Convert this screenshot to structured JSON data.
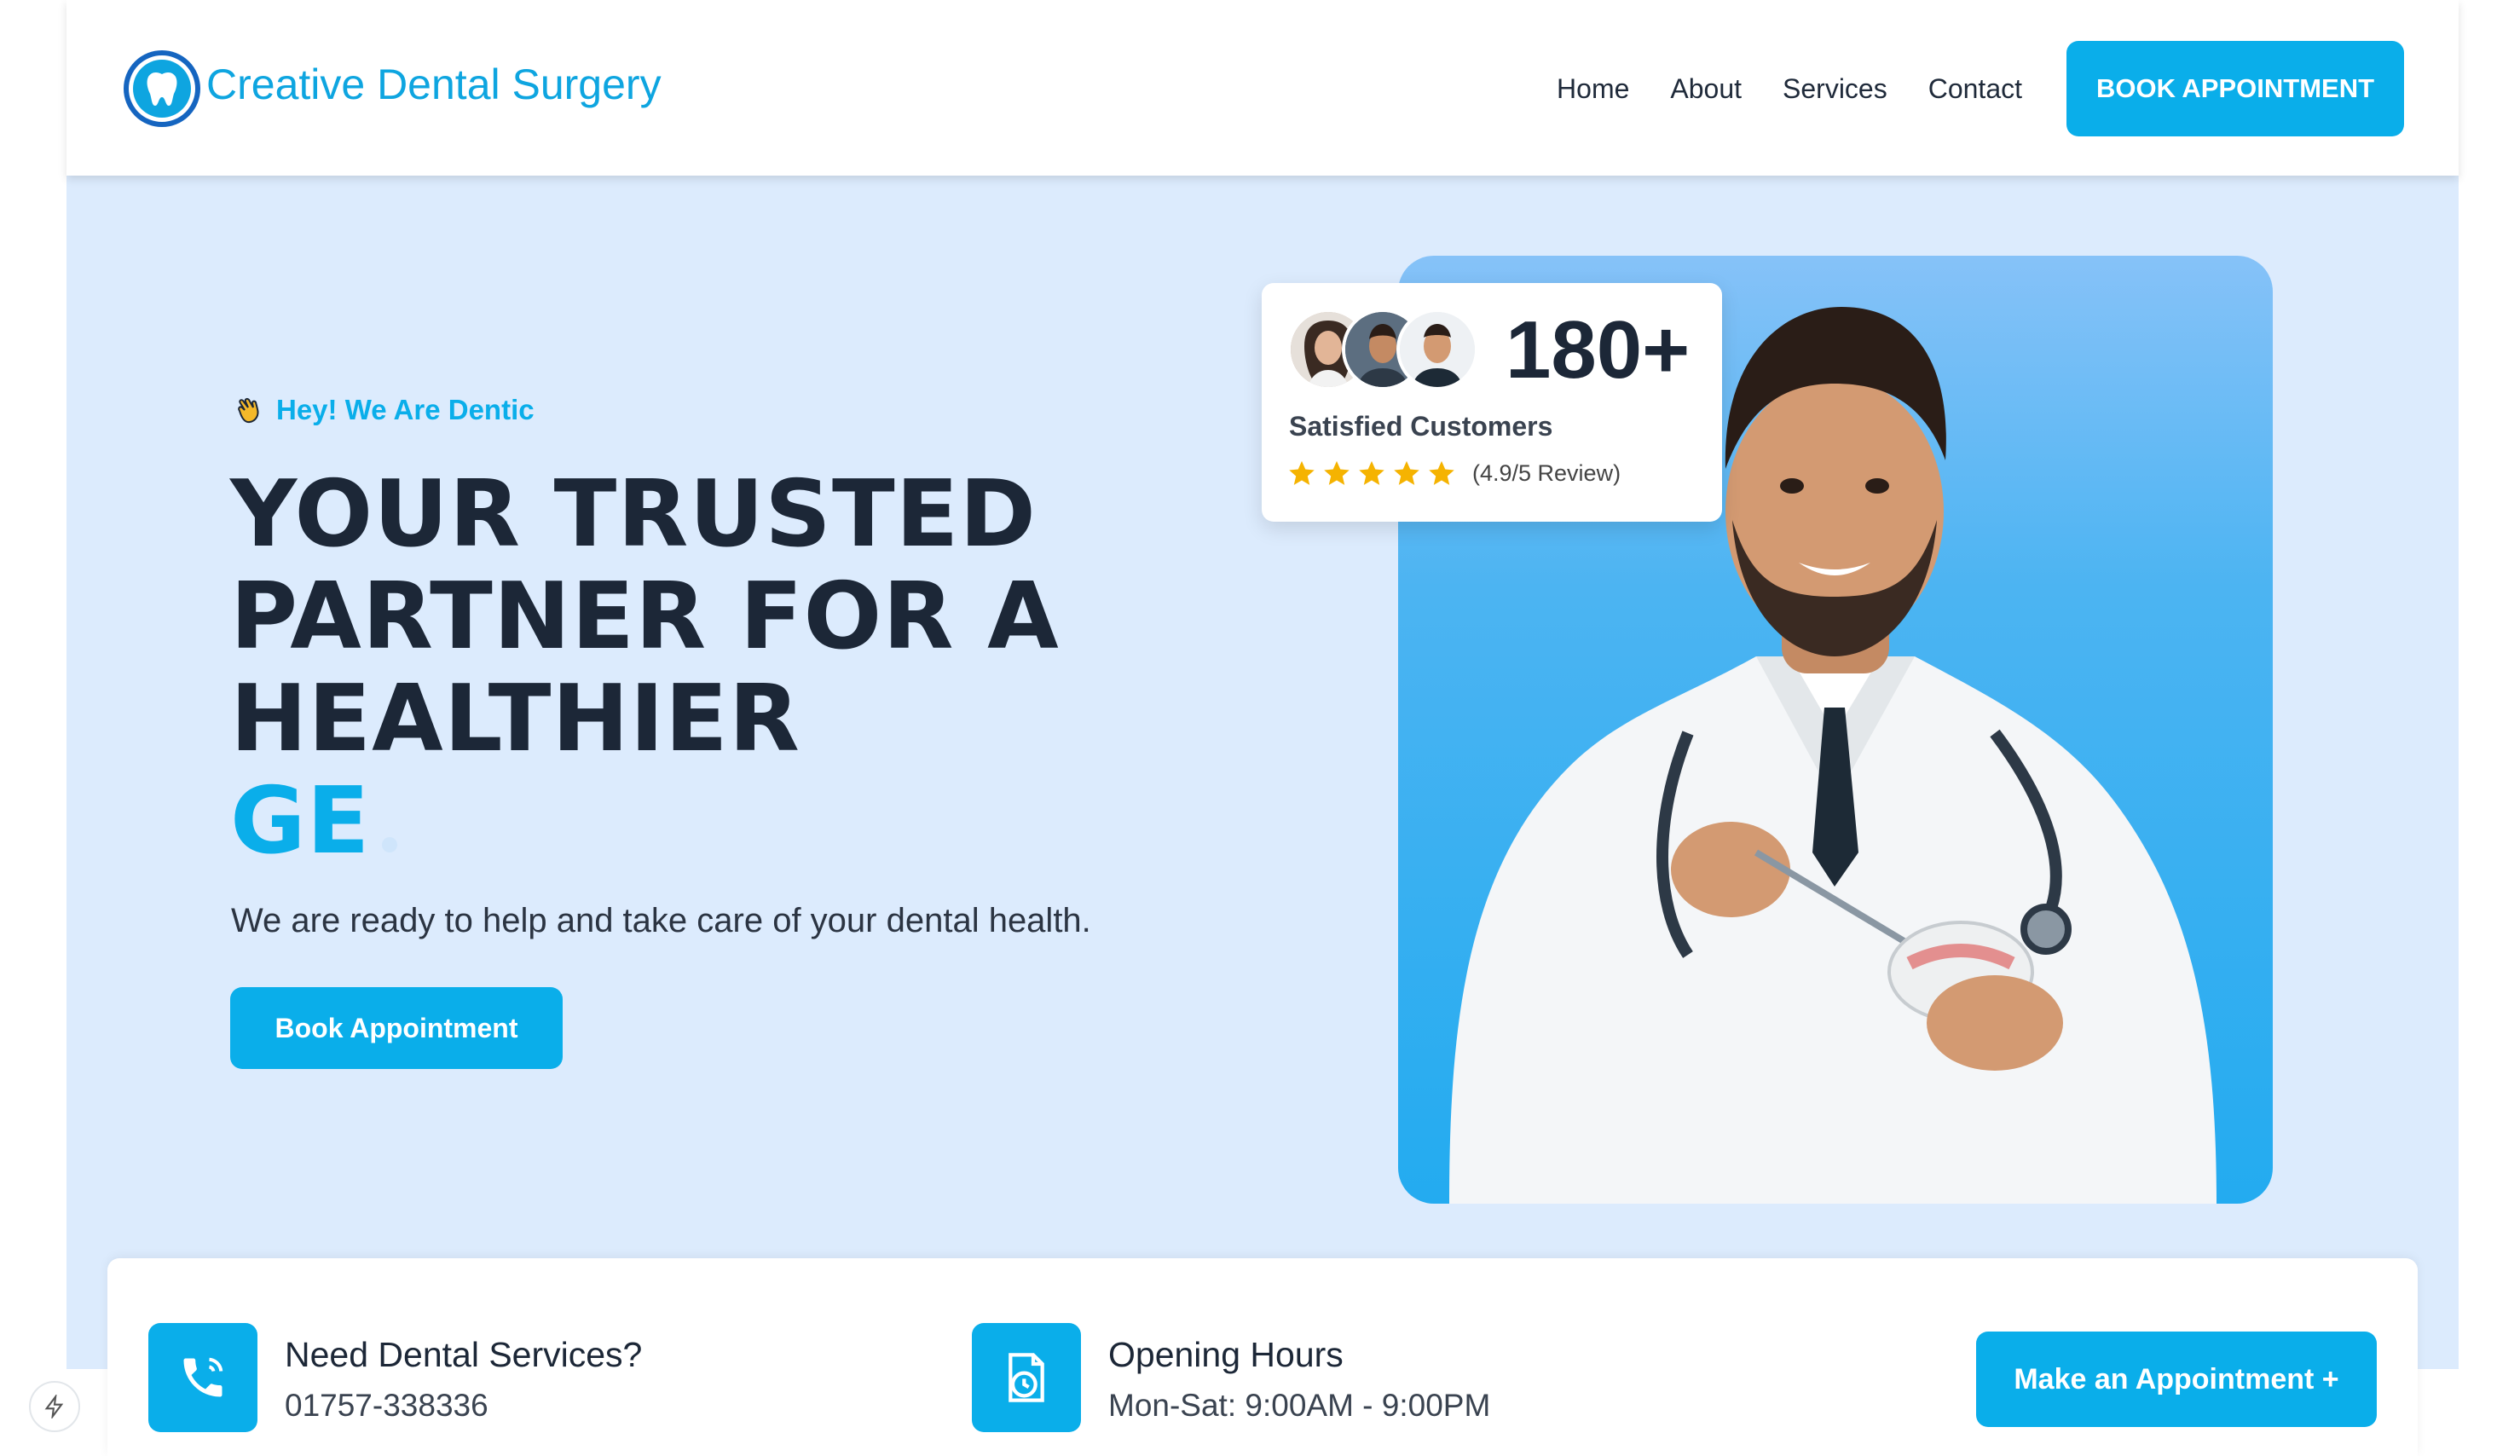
{
  "brand": {
    "name": "Creative Dental Surgery",
    "logo_icon": "tooth-icon"
  },
  "nav": {
    "items": [
      {
        "label": "Home"
      },
      {
        "label": "About"
      },
      {
        "label": "Services"
      },
      {
        "label": "Contact"
      }
    ],
    "cta_label": "BOOK APPOINTMENT"
  },
  "hero": {
    "tagline_icon": "waving-hand-icon",
    "tagline": "Hey! We Are Dentic",
    "headline_lines": [
      "YOUR TRUSTED",
      "PARTNER FOR A",
      "HEALTHIER"
    ],
    "headline_accent": "GE",
    "subtitle": "We are ready to help and take care of your dental health.",
    "button_label": "Book Appointment"
  },
  "reviews": {
    "count": "180+",
    "label": "Satisfied Customers",
    "rating_text": "(4.9/5 Review)",
    "stars": 5
  },
  "info": {
    "phone": {
      "title": "Need Dental Services?",
      "value": "01757-338336",
      "icon": "phone-icon"
    },
    "hours": {
      "title": "Opening Hours",
      "value": "Mon-Sat: 9:00AM - 9:00PM",
      "icon": "clock-document-icon"
    },
    "button_label": "Make an Appointment +"
  },
  "colors": {
    "accent": "#0aaeea",
    "hero_bg": "#dcebfd",
    "text_dark": "#1c2737"
  }
}
